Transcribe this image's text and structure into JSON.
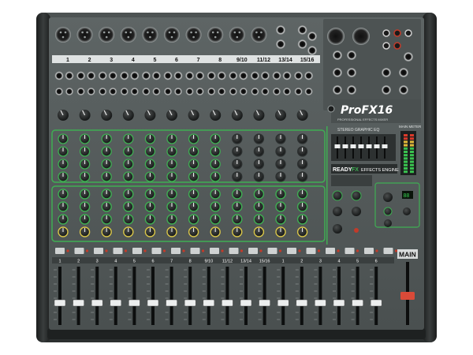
{
  "brand": {
    "model": "ProFX16",
    "tagline": "PROFESSIONAL EFFECTS MIXER",
    "ready": "READY",
    "fx": "FX",
    "effects_engine": "EFFECTS ENGINE"
  },
  "channel_labels": [
    "1",
    "2",
    "3",
    "4",
    "5",
    "6",
    "7",
    "8",
    "9/10",
    "11/12",
    "13/14",
    "15/16"
  ],
  "sub_labels": [
    "1",
    "2",
    "3",
    "4",
    "5",
    "6",
    "7",
    "8",
    "9/10",
    "11/12",
    "13/14",
    "15/16",
    "1",
    "2",
    "3",
    "4",
    "5",
    "6"
  ],
  "panel_labels": {
    "graphic_eq": "STEREO GRAPHIC EQ",
    "main_meter": "MAIN METER",
    "main": "MAIN"
  },
  "colors": {
    "chassis": "#3c4040",
    "panel": "#555b5b",
    "eq_green": "#3fae53",
    "aux_green": "#3fae53",
    "mute_red": "#c23b2a",
    "knob": "#1a1c1c"
  }
}
